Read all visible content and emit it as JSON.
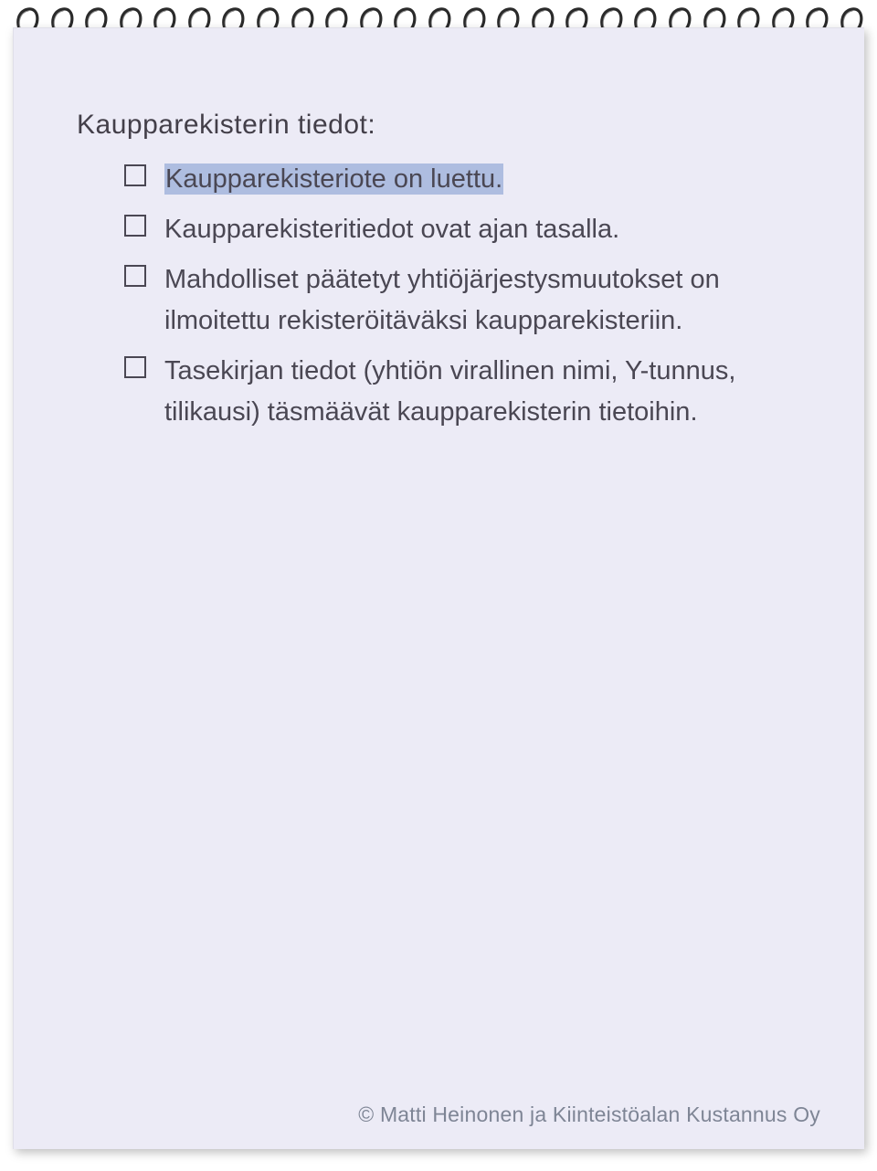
{
  "heading": "Kaupparekisterin tiedot:",
  "items": [
    {
      "text": "Kaupparekisteriote on luettu.",
      "highlighted": true
    },
    {
      "text": "Kaupparekisteritiedot ovat ajan tasalla.",
      "highlighted": false
    },
    {
      "text": "Mahdolliset päätetyt yhtiöjärjestysmuutokset on ilmoitettu rekisteröitäväksi kaupparekisteriin.",
      "highlighted": false
    },
    {
      "text": "Tasekirjan tiedot (yhtiön virallinen nimi, Y-tunnus, tilikausi) täsmäävät kaupparekisterin tietoihin.",
      "highlighted": false
    }
  ],
  "footer": "© Matti Heinonen ja Kiinteistöalan Kustannus Oy",
  "spiral_count": 25
}
